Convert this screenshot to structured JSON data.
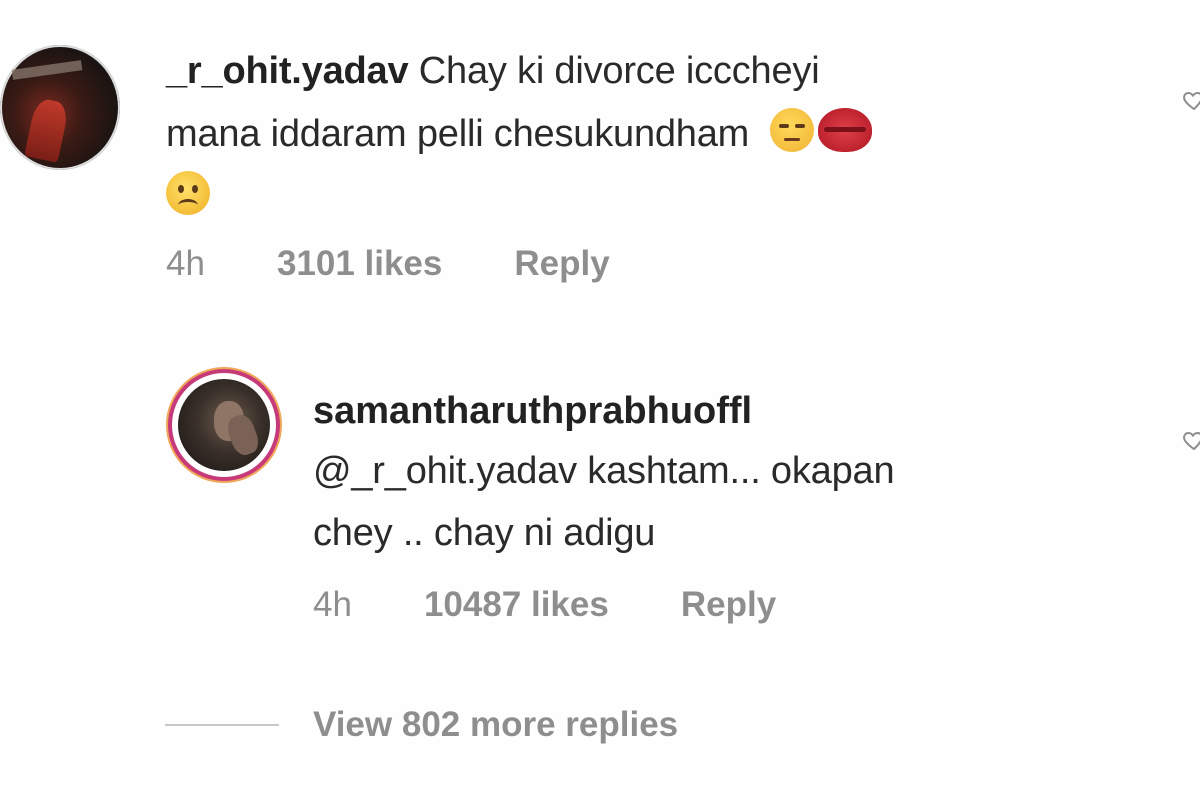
{
  "comment1": {
    "username": "_r_ohit.yadav",
    "text_line1": " Chay ki divorce icccheyi",
    "text_line2": "mana iddaram pelli chesukundham ",
    "emojis": [
      "unamused-face-emoji",
      "kiss-mark-emoji",
      "frowning-face-emoji"
    ],
    "time": "4h",
    "likes": "3101 likes",
    "reply_label": "Reply"
  },
  "comment2": {
    "username": "samantharuthprabhuoffl",
    "text_line1": "@_r_ohit.yadav kashtam... okapan",
    "text_line2": "chey .. chay ni adigu",
    "time": "4h",
    "likes": "10487 likes",
    "reply_label": "Reply"
  },
  "view_replies": {
    "label": "View 802 more replies"
  },
  "icons": {
    "like": "heart-icon"
  },
  "colors": {
    "text": "#262626",
    "meta": "#8e8e8e",
    "story_ring_start": "#c73a7a",
    "story_ring_end": "#f1a65a"
  }
}
